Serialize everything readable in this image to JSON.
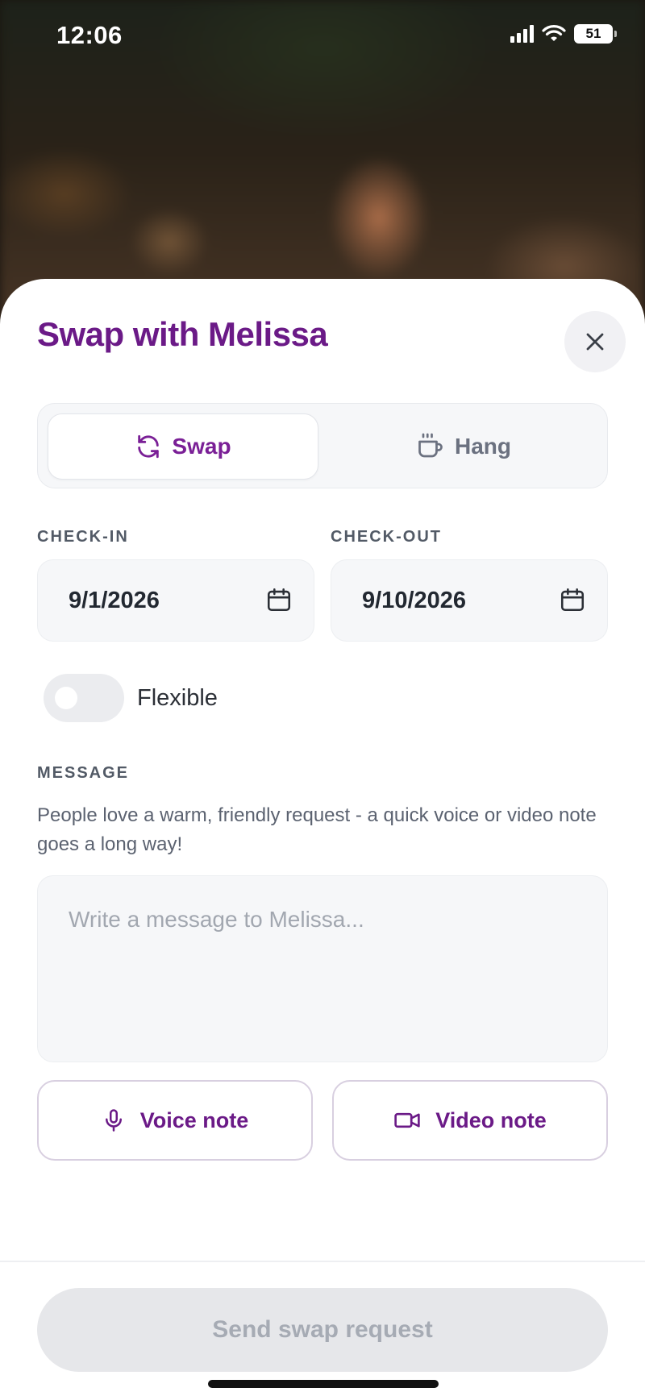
{
  "status_bar": {
    "time": "12:06",
    "battery": "51"
  },
  "sheet": {
    "title": "Swap with Melissa",
    "mode_tabs": [
      {
        "label": "Swap",
        "icon": "refresh-icon",
        "selected": true
      },
      {
        "label": "Hang",
        "icon": "coffee-cup-icon",
        "selected": false
      }
    ],
    "check_in": {
      "label": "CHECK-IN",
      "value": "9/1/2026"
    },
    "check_out": {
      "label": "CHECK-OUT",
      "value": "9/10/2026"
    },
    "flexible": {
      "label": "Flexible",
      "on": false
    },
    "message": {
      "label": "MESSAGE",
      "helper": "People love a warm, friendly request - a quick voice or video note goes a long way!",
      "placeholder": "Write a message to Melissa...",
      "value": ""
    },
    "voice_note_label": "Voice note",
    "video_note_label": "Video note",
    "send_label": "Send swap request"
  },
  "colors": {
    "brand_purple": "#6b1a87",
    "disabled_button": "#e6e7ea",
    "field_bg": "#f6f7f9"
  }
}
